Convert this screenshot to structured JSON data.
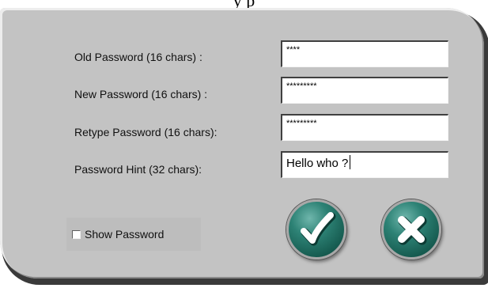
{
  "top_text": "      y       p",
  "fields": {
    "old_password": {
      "label": "Old Password (16 chars) :",
      "value": "****"
    },
    "new_password": {
      "label": "New Password (16 chars) :",
      "value": "*********"
    },
    "retype_password": {
      "label": "Retype Password (16 chars):",
      "value": "*********"
    },
    "password_hint": {
      "label": "Password Hint (32 chars):",
      "value": "Hello who ?"
    }
  },
  "show_password": {
    "label": "Show Password",
    "checked": false
  },
  "buttons": {
    "ok_icon": "checkmark-icon",
    "cancel_icon": "x-icon"
  },
  "colors": {
    "panel": "#c3c3c3",
    "button_teal": "#2d8275"
  }
}
